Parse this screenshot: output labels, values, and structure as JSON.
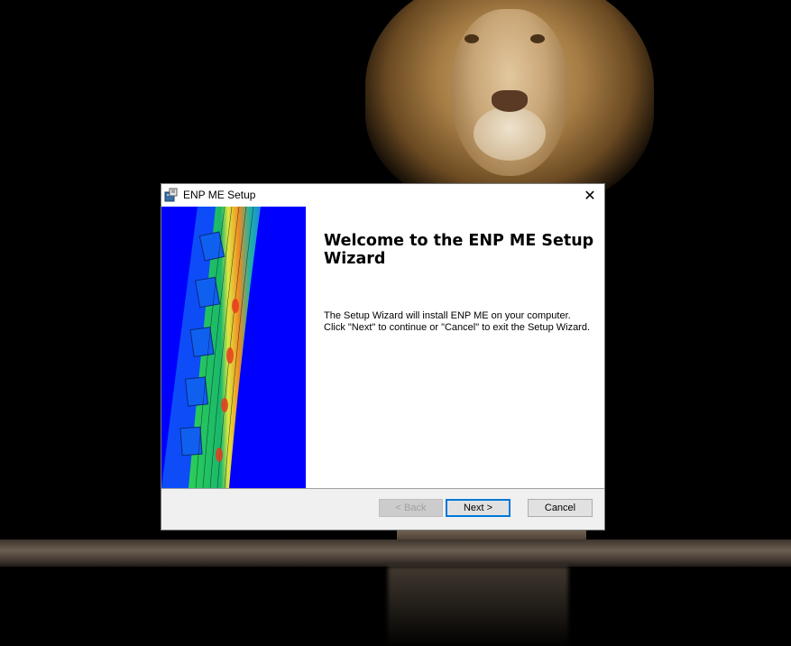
{
  "dialog": {
    "title": "ENP ME Setup",
    "close_symbol": "✕",
    "heading": "Welcome to the ENP ME Setup Wizard",
    "description": "The Setup Wizard will install ENP ME on your computer.  Click \"Next\" to continue or \"Cancel\" to exit the Setup Wizard.",
    "buttons": {
      "back": "< Back",
      "next": "Next >",
      "cancel": "Cancel"
    }
  },
  "icons": {
    "title_icon": "installer-icon",
    "close_icon": "close-icon"
  },
  "colors": {
    "side_image_background": "#0000ff",
    "focus_border": "#0078d7"
  }
}
